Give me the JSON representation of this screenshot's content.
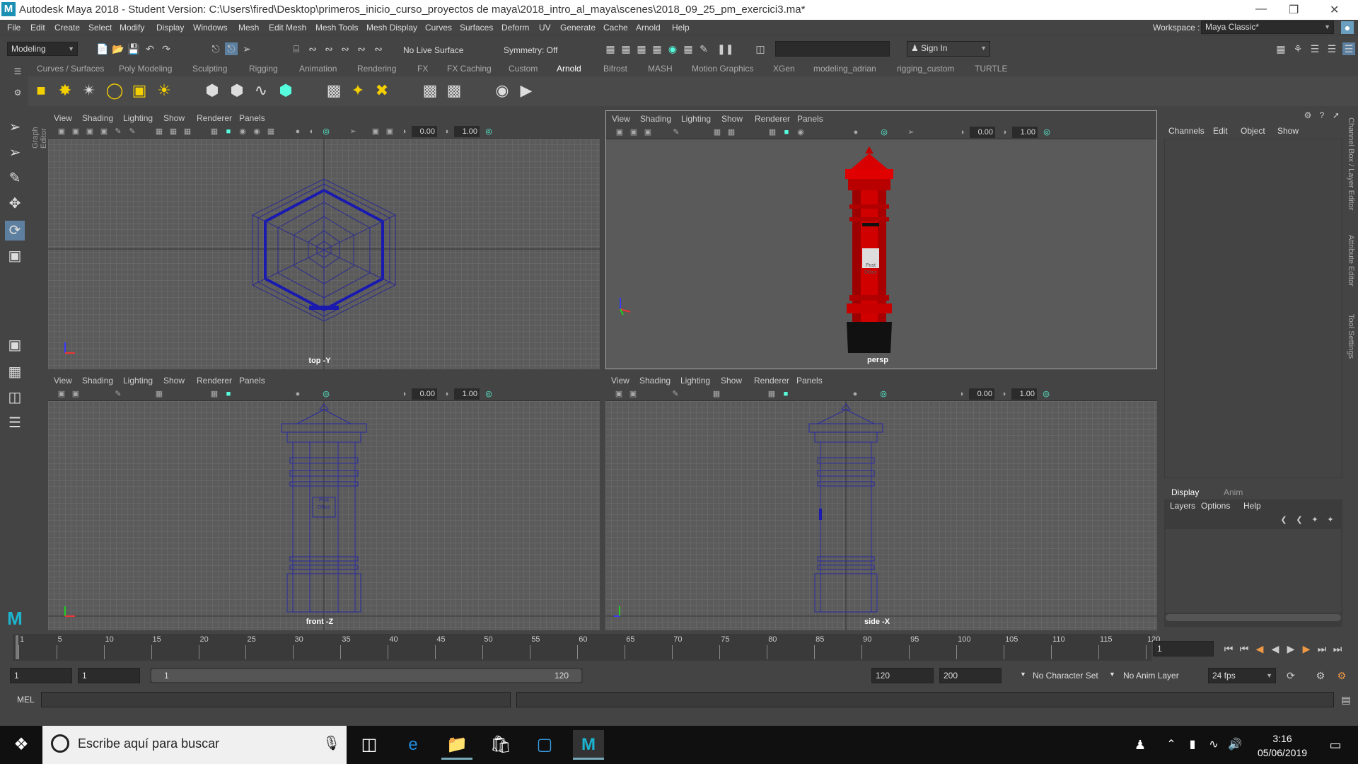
{
  "window": {
    "title": "Autodesk Maya 2018 - Student Version: C:\\Users\\fired\\Desktop\\primeros_inicio_curso_proyectos de maya\\2018_intro_al_maya\\scenes\\2018_09_25_pm_exercici3.ma*",
    "logo": "M"
  },
  "menu": [
    "File",
    "Edit",
    "Create",
    "Select",
    "Modify",
    "Display",
    "Windows",
    "Mesh",
    "Edit Mesh",
    "Mesh Tools",
    "Mesh Display",
    "Curves",
    "Surfaces",
    "Deform",
    "UV",
    "Generate",
    "Cache",
    "Arnold",
    "Help"
  ],
  "workspace": {
    "label": "Workspace :",
    "value": "Maya Classic*"
  },
  "toolbar": {
    "mode": "Modeling",
    "live_surface": "No Live Surface",
    "symmetry": "Symmetry: Off",
    "sign_in": "Sign In"
  },
  "shelf_tabs": [
    "Curves / Surfaces",
    "Poly Modeling",
    "Sculpting",
    "Rigging",
    "Animation",
    "Rendering",
    "FX",
    "FX Caching",
    "Custom",
    "Arnold",
    "Bifrost",
    "MASH",
    "Motion Graphics",
    "XGen",
    "modeling_adrian",
    "rigging_custom",
    "TURTLE"
  ],
  "shelf_active": "Arnold",
  "side_label": "Graph Editor",
  "viewport_menu": [
    "View",
    "Shading",
    "Lighting",
    "Show",
    "Renderer",
    "Panels"
  ],
  "viewport_values": {
    "exposure": "0.00",
    "gamma": "1.00"
  },
  "viewports": [
    {
      "name": "top",
      "label": "top -Y"
    },
    {
      "name": "persp",
      "label": "persp"
    },
    {
      "name": "front",
      "label": "front -Z"
    },
    {
      "name": "side",
      "label": "side -X"
    }
  ],
  "model_sign": {
    "line1": "Post",
    "line2": "Office"
  },
  "channel_box": {
    "menu": [
      "Channels",
      "Edit",
      "Object",
      "Show"
    ]
  },
  "side_tabs": [
    "Channel Box / Layer Editor",
    "Attribute Editor",
    "Tool Settings"
  ],
  "layer_editor": {
    "tabs": [
      "Display",
      "Anim"
    ],
    "menu": [
      "Layers",
      "Options",
      "Help"
    ]
  },
  "timeline": {
    "ticks": [
      "1",
      "5",
      "10",
      "15",
      "20",
      "25",
      "30",
      "35",
      "40",
      "45",
      "50",
      "55",
      "60",
      "65",
      "70",
      "75",
      "80",
      "85",
      "90",
      "95",
      "100",
      "105",
      "110",
      "115",
      "120"
    ],
    "current_frame": "1"
  },
  "range": {
    "start": "1",
    "playback_start": "1",
    "slider_start": "1",
    "slider_end": "120",
    "playback_end": "120",
    "end": "200",
    "character_set": "No Character Set",
    "anim_layer": "No Anim Layer",
    "fps": "24 fps"
  },
  "command_line": {
    "label": "MEL"
  },
  "taskbar": {
    "search_placeholder": "Escribe aquí para buscar",
    "time": "3:16",
    "date": "05/06/2019"
  }
}
